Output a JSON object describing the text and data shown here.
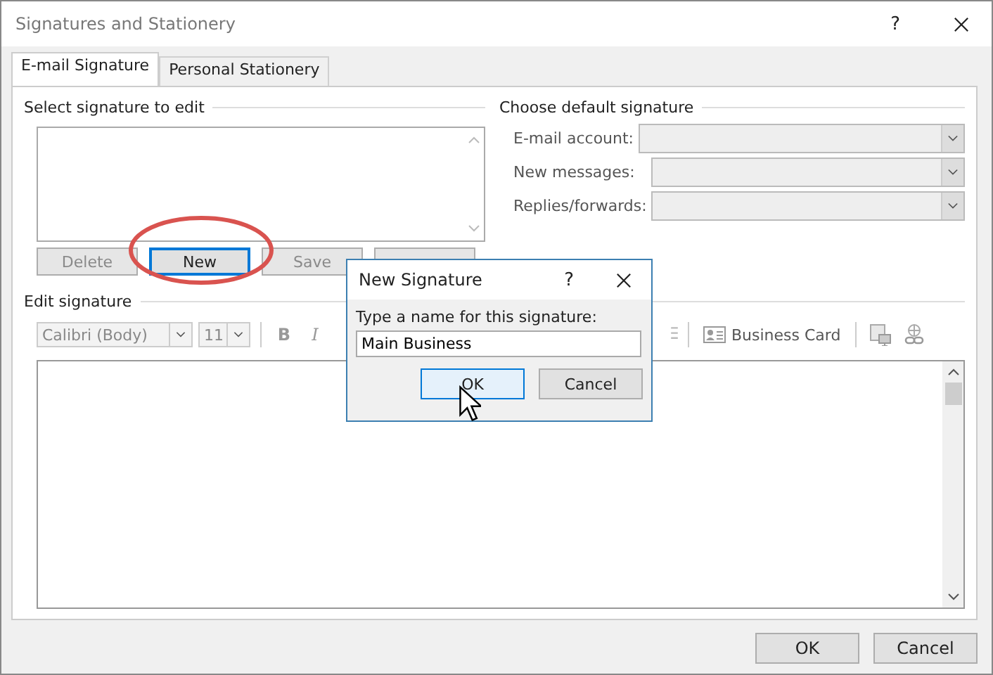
{
  "window": {
    "title": "Signatures and Stationery",
    "help": "?"
  },
  "tabs": [
    {
      "label": "E-mail Signature",
      "selected": true
    },
    {
      "label": "Personal Stationery",
      "selected": false
    }
  ],
  "select_signature": {
    "label": "Select signature to edit",
    "buttons": [
      {
        "label": "Delete",
        "disabled": true,
        "focused": false
      },
      {
        "label": "New",
        "disabled": false,
        "focused": true
      },
      {
        "label": "Save",
        "disabled": true,
        "focused": false
      }
    ]
  },
  "default_signature": {
    "label": "Choose default signature",
    "fields": [
      {
        "label": "E-mail account:"
      },
      {
        "label": "New messages:"
      },
      {
        "label": "Replies/forwards:"
      }
    ]
  },
  "edit_signature": {
    "label": "Edit signature",
    "font": "Calibri (Body)",
    "size": "11",
    "bold": "B",
    "italic": "I",
    "business_card": "Business Card"
  },
  "new_signature_dialog": {
    "title": "New Signature",
    "help": "?",
    "prompt": "Type a name for this signature:",
    "value": "Main Business",
    "buttons": [
      {
        "label": "OK",
        "focused": true
      },
      {
        "label": "Cancel",
        "focused": false
      }
    ]
  },
  "footer_buttons": [
    {
      "label": "OK"
    },
    {
      "label": "Cancel"
    }
  ]
}
